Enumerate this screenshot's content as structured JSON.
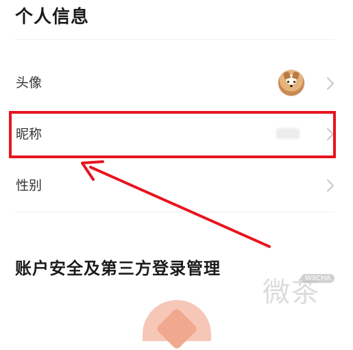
{
  "sections": {
    "personal_info_title": "个人信息",
    "account_security_title": "账户安全及第三方登录管理"
  },
  "rows": {
    "avatar_label": "头像",
    "nickname_label": "昵称",
    "gender_label": "性别"
  },
  "watermark": {
    "text": "微茶",
    "badge": "WXCHA"
  },
  "colors": {
    "highlight": "#e8141e",
    "arrow": "#e8141e",
    "divider": "#efefef",
    "chevron": "#c8c8c8"
  },
  "icons": [
    "chevron-right-icon",
    "avatar",
    "arrow-annotation"
  ]
}
